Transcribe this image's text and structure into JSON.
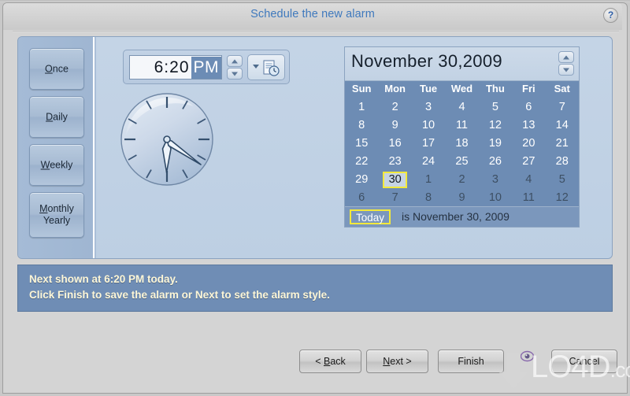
{
  "window": {
    "title": "Schedule the new alarm",
    "help_icon": "question-mark-icon",
    "help_label": "?"
  },
  "sidebar": {
    "items": [
      {
        "id": "once",
        "label": "Once",
        "accel": "O",
        "rest": "nce",
        "selected": true
      },
      {
        "id": "daily",
        "label": "Daily",
        "accel": "D",
        "rest": "aily",
        "selected": false
      },
      {
        "id": "weekly",
        "label": "Weekly",
        "accel": "W",
        "rest": "eekly",
        "selected": false
      },
      {
        "id": "monthly_yearly",
        "label": "Monthly Yearly",
        "accel": "M",
        "rest": "onthly",
        "line2": "Yearly",
        "selected": false
      }
    ]
  },
  "time": {
    "hours_minutes": "6:20",
    "meridiem": "PM",
    "meridiem_selected": true,
    "spinner_up_icon": "chevron-up-icon",
    "spinner_down_icon": "chevron-down-icon",
    "dropdown_icon": "chevron-down-icon",
    "button_icon": "document-clock-icon"
  },
  "clock": {
    "hour_value": 6,
    "minute_value": 20,
    "label": "analog clock showing 6:20"
  },
  "calendar": {
    "title": "November  30,2009",
    "spinner_up_icon": "chevron-up-icon",
    "spinner_down_icon": "chevron-down-icon",
    "day_headers": [
      "Sun",
      "Mon",
      "Tue",
      "Wed",
      "Thu",
      "Fri",
      "Sat"
    ],
    "weeks": [
      [
        {
          "d": "1",
          "o": false
        },
        {
          "d": "2",
          "o": false
        },
        {
          "d": "3",
          "o": false
        },
        {
          "d": "4",
          "o": false
        },
        {
          "d": "5",
          "o": false
        },
        {
          "d": "6",
          "o": false
        },
        {
          "d": "7",
          "o": false
        }
      ],
      [
        {
          "d": "8",
          "o": false
        },
        {
          "d": "9",
          "o": false
        },
        {
          "d": "10",
          "o": false
        },
        {
          "d": "11",
          "o": false
        },
        {
          "d": "12",
          "o": false
        },
        {
          "d": "13",
          "o": false
        },
        {
          "d": "14",
          "o": false
        }
      ],
      [
        {
          "d": "15",
          "o": false
        },
        {
          "d": "16",
          "o": false
        },
        {
          "d": "17",
          "o": false
        },
        {
          "d": "18",
          "o": false
        },
        {
          "d": "19",
          "o": false
        },
        {
          "d": "20",
          "o": false
        },
        {
          "d": "21",
          "o": false
        }
      ],
      [
        {
          "d": "22",
          "o": false
        },
        {
          "d": "23",
          "o": false
        },
        {
          "d": "24",
          "o": false
        },
        {
          "d": "25",
          "o": false
        },
        {
          "d": "26",
          "o": false
        },
        {
          "d": "27",
          "o": false
        },
        {
          "d": "28",
          "o": false
        }
      ],
      [
        {
          "d": "29",
          "o": false
        },
        {
          "d": "30",
          "o": false,
          "sel": true
        },
        {
          "d": "1",
          "o": true
        },
        {
          "d": "2",
          "o": true
        },
        {
          "d": "3",
          "o": true
        },
        {
          "d": "4",
          "o": true
        },
        {
          "d": "5",
          "o": true
        }
      ],
      [
        {
          "d": "6",
          "o": true
        },
        {
          "d": "7",
          "o": true
        },
        {
          "d": "8",
          "o": true
        },
        {
          "d": "9",
          "o": true
        },
        {
          "d": "10",
          "o": true
        },
        {
          "d": "11",
          "o": true
        },
        {
          "d": "12",
          "o": true
        }
      ]
    ],
    "today_button": "Today",
    "today_text": "is November 30, 2009"
  },
  "message": {
    "line1": "Next shown at 6:20 PM today.",
    "line2": "Click Finish to save the alarm or Next to set the alarm style."
  },
  "buttons": {
    "back": {
      "prefix": "< ",
      "accel": "B",
      "rest": "ack"
    },
    "next": {
      "prefix": "",
      "accel": "N",
      "rest": "ext >"
    },
    "finish": {
      "label": "Finish"
    },
    "cancel": {
      "label": "Cancel"
    }
  },
  "watermark": {
    "text": "LO4D",
    "domain": ".com",
    "arrow_icon": "download-arrow-icon",
    "eye_icon": "eye-icon"
  },
  "colors": {
    "title_blue": "#3f79bd",
    "panel_blue": "#aabfd8",
    "calendar_blue": "#6d8cb4",
    "selection_yellow": "#f3e93a",
    "message_bg": "#6f8db5",
    "message_text": "#fdf7d8"
  }
}
